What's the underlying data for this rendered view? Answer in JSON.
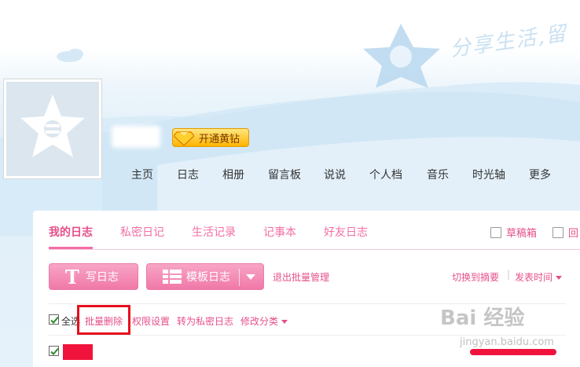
{
  "header": {
    "slogan": "分享生活,留",
    "vip_label": "开通黄钻"
  },
  "nav": {
    "items": [
      "主页",
      "日志",
      "相册",
      "留言板",
      "说说",
      "个人档",
      "音乐",
      "时光轴",
      "更多"
    ]
  },
  "tabs": {
    "items": [
      "我的日志",
      "私密日记",
      "生活记录",
      "记事本",
      "好友日志"
    ],
    "active": "我的日志"
  },
  "tools": {
    "drafts": "草稿箱",
    "recycle": "回"
  },
  "actions": {
    "write": "写日志",
    "write_glyph": "T",
    "template": "模板日志",
    "exit_batch": "退出批量管理",
    "switch_summary": "切换到摘要",
    "sort": "发表时间"
  },
  "batch": {
    "select_all": "全选",
    "delete": "批量删除",
    "permissions": "权限设置",
    "to_private": "转为私密日志",
    "change_category": "修改分类"
  },
  "watermark": {
    "brand": "Bai 经验",
    "url": "jingyan.baidu.com"
  },
  "colors": {
    "accent": "#e64f8a",
    "button": "#f078a8",
    "highlight": "#e8101e"
  }
}
